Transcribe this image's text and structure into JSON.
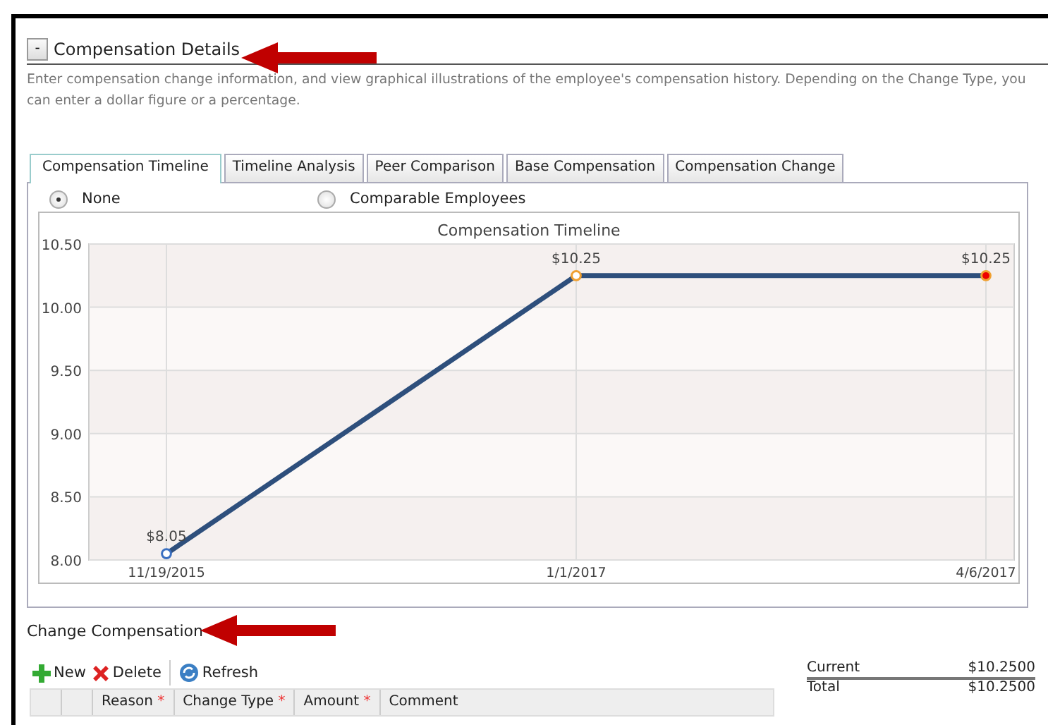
{
  "section": {
    "toggle": "-",
    "title": "Compensation Details",
    "description": "Enter compensation change information, and view graphical illustrations of the employee's compensation history. Depending on the Change Type, you can enter a dollar figure or a percentage."
  },
  "tabs": [
    {
      "label": "Compensation Timeline",
      "selected": true
    },
    {
      "label": "Timeline Analysis",
      "selected": false
    },
    {
      "label": "Peer Comparison",
      "selected": false
    },
    {
      "label": "Base Compensation",
      "selected": false
    },
    {
      "label": "Compensation Change",
      "selected": false
    }
  ],
  "compare_options": [
    {
      "label": "None",
      "selected": true
    },
    {
      "label": "Comparable Employees",
      "selected": false
    }
  ],
  "chart": {
    "chart_data": {
      "type": "line",
      "title": "Compensation Timeline",
      "categories": [
        "11/19/2015",
        "1/1/2017",
        "4/6/2017"
      ],
      "series": [
        {
          "color": "#2e4f7c",
          "marker": true,
          "values": [
            8.05,
            10.25,
            10.25
          ]
        }
      ],
      "grid": true,
      "ylim": [
        8,
        10.5
      ],
      "yticks": [
        {
          "value": 8,
          "label": "8.00"
        },
        {
          "value": 8.5,
          "label": "8.50"
        },
        {
          "value": 9,
          "label": "9.00"
        },
        {
          "value": 9.5,
          "label": "9.50"
        },
        {
          "value": 10,
          "label": "10.00"
        },
        {
          "value": 10.5,
          "label": "10.50"
        }
      ],
      "value_labels": [
        "$8.05",
        "$10.25",
        "$10.25"
      ]
    }
  },
  "change_section": {
    "title": "Change Compensation"
  },
  "toolbar": [
    {
      "label": "New",
      "kind": "new"
    },
    {
      "label": "Delete",
      "kind": "delete"
    },
    {
      "label": "Refresh",
      "kind": "refresh"
    }
  ],
  "table": {
    "columns": [
      {
        "label": "Reason",
        "required_mark": "*"
      },
      {
        "label": "Change Type",
        "required_mark": "*"
      },
      {
        "label": "Amount",
        "required_mark": "*"
      },
      {
        "label": "Comment"
      }
    ]
  },
  "summary": [
    {
      "label": "Current",
      "value": "$10.2500"
    },
    {
      "label": "Total",
      "value": "$10.2500"
    }
  ]
}
